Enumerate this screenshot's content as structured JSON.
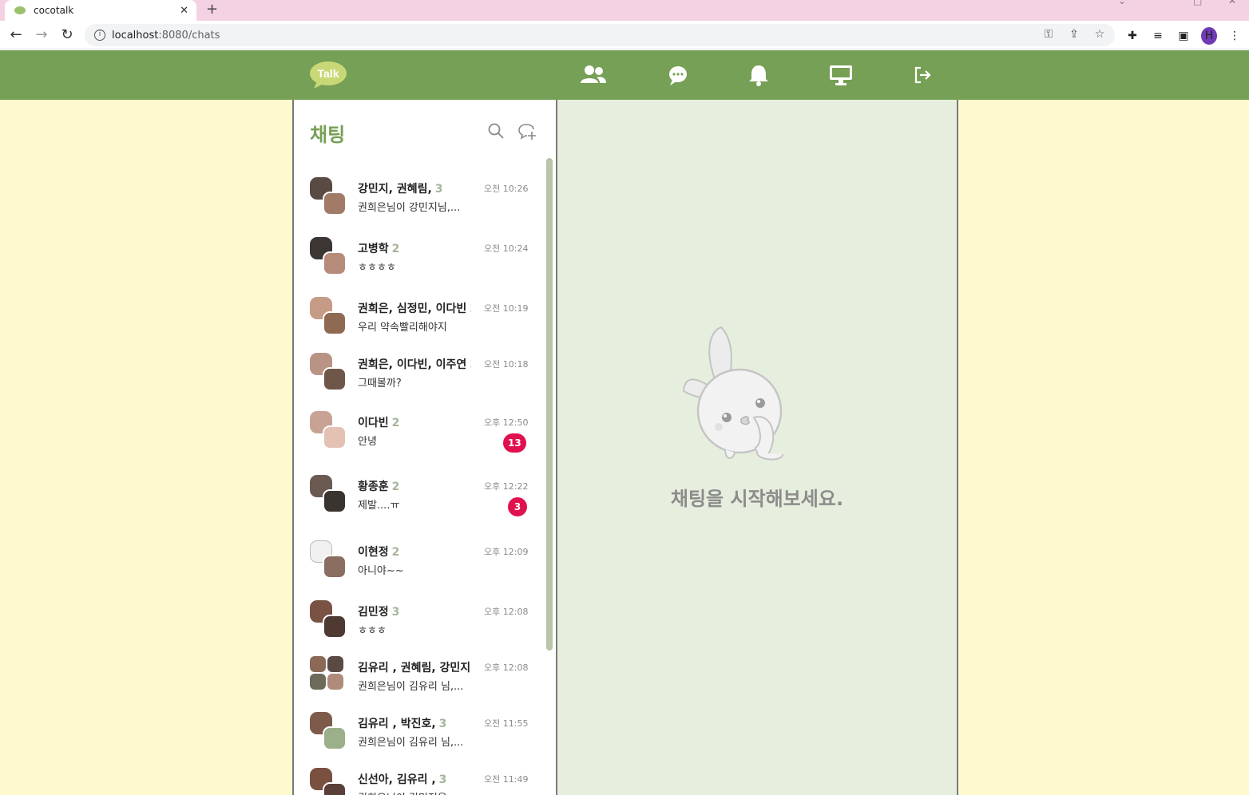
{
  "browser": {
    "tab_title": "cocotalk",
    "tab_close": "✕",
    "new_tab": "+",
    "url_host": "localhost",
    "url_rest": ":8080/chats",
    "profile_initial": "H"
  },
  "app": {
    "logo_text": "Talk",
    "nav": [
      "friends-icon",
      "chat-icon",
      "bell-icon",
      "monitor-icon",
      "logout-icon"
    ]
  },
  "chat_panel": {
    "title": "채팅",
    "items": [
      {
        "name": "강민지, 권혜림,",
        "count": "3",
        "preview": "권희은님이 강민지님,...",
        "time": "오전 10:26",
        "badge": ""
      },
      {
        "name": "고병학",
        "count": "2",
        "preview": "ㅎㅎㅎㅎ",
        "time": "오전 10:24",
        "badge": ""
      },
      {
        "name": "권희은, 심정민, 이다빈",
        "count": "3",
        "preview": "우리 약속빨리해야지",
        "time": "오전 10:19",
        "badge": ""
      },
      {
        "name": "권희은, 이다빈, 이주연",
        "count": "3",
        "preview": "그때볼까?",
        "time": "오전 10:18",
        "badge": ""
      },
      {
        "name": "이다빈",
        "count": "2",
        "preview": "안녕",
        "time": "오후 12:50",
        "badge": "13"
      },
      {
        "name": "황종훈",
        "count": "2",
        "preview": "제발....ㅠ",
        "time": "오후 12:22",
        "badge": "3"
      },
      {
        "name": "이현정",
        "count": "2",
        "preview": "아니야~~",
        "time": "오후 12:09",
        "badge": ""
      },
      {
        "name": "김민정",
        "count": "3",
        "preview": "ㅎㅎㅎ",
        "time": "오후 12:08",
        "badge": ""
      },
      {
        "name": "김유리 , 권혜림, 강민지,",
        "count": "",
        "preview": "권희은님이 김유리 님,...",
        "time": "오후 12:08",
        "badge": ""
      },
      {
        "name": "김유리 , 박진호,",
        "count": "3",
        "preview": "권희은님이 김유리 님,...",
        "time": "오전 11:55",
        "badge": ""
      },
      {
        "name": "신선아, 김유리 ,",
        "count": "3",
        "preview": "권희은님이 김민정을...",
        "time": "오전 11:49",
        "badge": ""
      }
    ]
  },
  "empty_state": {
    "message": "채팅을 시작해보세요."
  },
  "colors": {
    "header_green": "#76a055",
    "page_bg": "#fef9ce",
    "right_panel_bg": "#e6efde",
    "badge_red": "#e0114e"
  }
}
